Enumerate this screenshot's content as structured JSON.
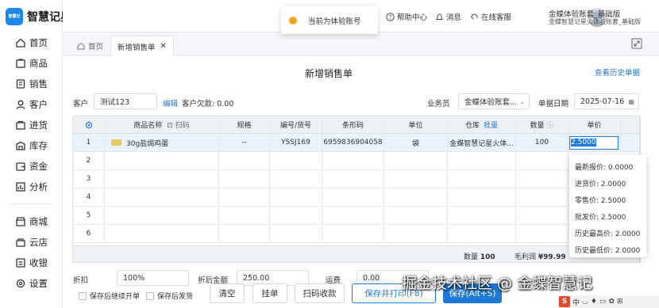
{
  "app": {
    "name": "智慧记星火",
    "logo_text": "智慧记"
  },
  "sidebar": {
    "items": [
      {
        "label": "首页",
        "icon": "home-icon"
      },
      {
        "label": "商品",
        "icon": "goods-icon"
      },
      {
        "label": "销售",
        "icon": "sales-icon"
      },
      {
        "label": "客户",
        "icon": "customer-icon"
      },
      {
        "label": "进货",
        "icon": "purchase-icon"
      },
      {
        "label": "库存",
        "icon": "inventory-icon"
      },
      {
        "label": "资金",
        "icon": "money-icon"
      },
      {
        "label": "分析",
        "icon": "analysis-icon"
      }
    ],
    "bottom_items": [
      {
        "label": "商城",
        "icon": "store-icon"
      },
      {
        "label": "云店",
        "icon": "cloud-shop-icon"
      },
      {
        "label": "收银",
        "icon": "cashier-icon"
      },
      {
        "label": "设置",
        "icon": "settings-icon"
      }
    ]
  },
  "topbar": {
    "toast": "当前为体验账号",
    "help": "帮助中心",
    "messages": "消息",
    "online_service": "在线客服",
    "account_name": "金蝶体验账套_基础版",
    "account_org": "金蝶智慧记星火体验账套_基础版"
  },
  "tabs": [
    {
      "label": "首页"
    },
    {
      "label": "新增销售单"
    }
  ],
  "form": {
    "title": "新增销售单",
    "history_link": "查看历史单据",
    "customer_label": "客户",
    "customer_value": "测试123",
    "edit_link": "编辑",
    "debt_label": "客户欠款:",
    "debt_value": "0.00",
    "salesman_label": "业务员",
    "salesman_value": "金蝶体验账套...",
    "date_label": "单据日期",
    "date_value": "2025-07-16"
  },
  "table": {
    "headers": {
      "name": "商品名称",
      "scan": "扫码",
      "spec": "规格",
      "code": "编号/货号",
      "barcode": "条形码",
      "unit": "单位",
      "warehouse": "仓库",
      "batch": "批量",
      "qty": "数量",
      "price": "单价"
    },
    "rows": [
      {
        "no": "1",
        "name": "30g盐焗鸡蛋",
        "spec": "--",
        "code": "YSSJ169",
        "barcode": "6959836904058",
        "unit": "袋",
        "warehouse": "金蝶智慧记星火体...",
        "qty": "100",
        "price": "2.5000"
      },
      {
        "no": "2"
      },
      {
        "no": "3"
      },
      {
        "no": "4"
      },
      {
        "no": "5"
      },
      {
        "no": "6"
      }
    ],
    "footer": {
      "qty_label": "数量",
      "qty_value": "100",
      "profit_label": "毛利润",
      "profit_value": "¥99.99"
    }
  },
  "price_popup": [
    "最新报价: 0.0000",
    "进货价: 2.0000",
    "零售价: 2.5000",
    "批发价: 2.5000",
    "历史最高价: 2.0000",
    "历史最低价: 2.0000"
  ],
  "bottom": {
    "discount_label": "折扣",
    "discount_value": "100%",
    "after_label": "折后金额",
    "after_value": "250.00",
    "freight_label": "运费",
    "freight_value": "0.00",
    "continue_label": "保存后继续开单",
    "deliver_label": "保存后发货",
    "clear": "清空",
    "hold": "挂单",
    "scan_pay": "扫码收款",
    "save_print": "保存并打印(F8)",
    "save": "保存(Alt+S)"
  },
  "watermark": "掘金技术社区 @ 金蝶智慧记",
  "ime": {
    "logo": "S",
    "lang": "中"
  }
}
